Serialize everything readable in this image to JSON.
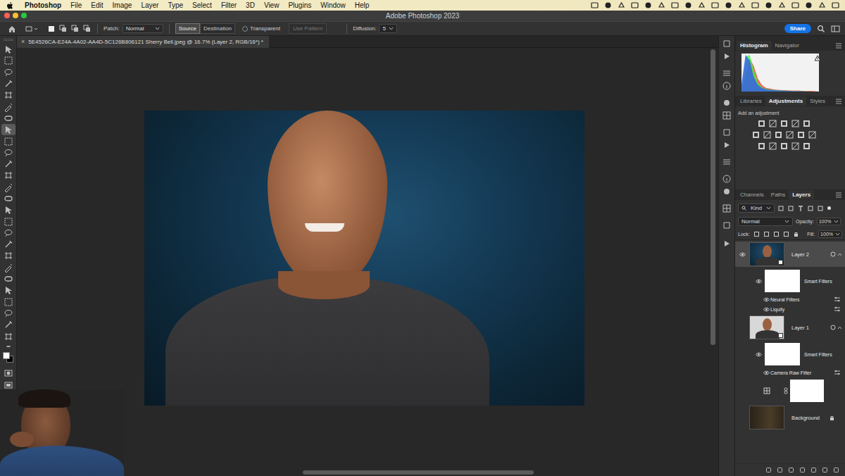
{
  "menubar": {
    "app": "Photoshop",
    "items": [
      "File",
      "Edit",
      "Image",
      "Layer",
      "Type",
      "Select",
      "Filter",
      "3D",
      "View",
      "Plugins",
      "Window",
      "Help"
    ]
  },
  "window": {
    "title": "Adobe Photoshop 2023"
  },
  "toolbar": {
    "tools": [
      {
        "selected": false
      },
      {
        "selected": false
      },
      {
        "selected": false
      },
      {
        "selected": false
      },
      {
        "selected": false
      },
      {
        "selected": false
      },
      {
        "selected": false
      },
      {
        "selected": true
      },
      {
        "selected": false
      },
      {
        "selected": false
      },
      {
        "selected": false
      },
      {
        "selected": false
      },
      {
        "selected": false
      },
      {
        "selected": false
      },
      {
        "selected": false
      },
      {
        "selected": false
      },
      {
        "selected": false
      },
      {
        "selected": false
      },
      {
        "selected": false
      },
      {
        "selected": false
      },
      {
        "selected": false
      },
      {
        "selected": false
      },
      {
        "selected": false
      },
      {
        "selected": false
      },
      {
        "selected": false
      },
      {
        "selected": false
      }
    ],
    "more": "•••"
  },
  "options": {
    "patch_label": "Patch:",
    "patch_mode": "Normal",
    "source": {
      "label": "Source",
      "selected": true
    },
    "destination": {
      "label": "Destination",
      "selected": false
    },
    "transparent": {
      "label": "Transparent",
      "checked": false
    },
    "use_pattern": {
      "label": "Use Pattern",
      "disabled": true
    },
    "diffusion_label": "Diffusion:",
    "diffusion_value": "5",
    "share": "Share"
  },
  "document": {
    "close": "×",
    "tab": "5E4526CA-E24A-4A02-AA4D-5C126B806121 Sherry Bell.jpeg @ 16.7% (Layer 2, RGB/16*) *"
  },
  "panels": {
    "top_tabs": [
      {
        "label": "Histogram",
        "selected": true
      },
      {
        "label": "Navigator",
        "selected": false
      }
    ],
    "histogram": {
      "series": [
        {
          "color": "#ff3030",
          "values": [
            5,
            40,
            90,
            70,
            35,
            18,
            10,
            8,
            6,
            5,
            4,
            4,
            3,
            3,
            3,
            2,
            2,
            2,
            1,
            0
          ]
        },
        {
          "color": "#30ff30",
          "values": [
            10,
            95,
            100,
            60,
            25,
            12,
            8,
            6,
            5,
            4,
            3,
            3,
            2,
            2,
            1,
            1,
            1,
            0,
            0,
            0
          ]
        },
        {
          "color": "#3050ff",
          "values": [
            20,
            100,
            85,
            40,
            18,
            10,
            7,
            5,
            4,
            3,
            3,
            2,
            2,
            1,
            1,
            1,
            0,
            0,
            0,
            0
          ]
        }
      ]
    },
    "mid_tabs": [
      {
        "label": "Libraries",
        "selected": false
      },
      {
        "label": "Adjustments",
        "selected": true
      },
      {
        "label": "Styles",
        "selected": false
      }
    ],
    "adjust_hint": "Add an adjustment",
    "bottom_tabs": [
      {
        "label": "Channels",
        "selected": false
      },
      {
        "label": "Paths",
        "selected": false
      },
      {
        "label": "Layers",
        "selected": true
      }
    ]
  },
  "layers_panel": {
    "filter": "Kind",
    "blend": "Normal",
    "opacity_label": "Opacity:",
    "opacity": "100%",
    "lock_label": "Lock:",
    "fill_label": "Fill:",
    "fill": "100%",
    "layers": [
      {
        "kind": "layer",
        "name": "Layer 2",
        "visible": true,
        "selected": true
      },
      {
        "kind": "smart-filters",
        "name": "Smart Filters",
        "visible": true
      },
      {
        "kind": "filter",
        "name": "Neural Filters",
        "visible": true
      },
      {
        "kind": "filter",
        "name": "Liquify",
        "visible": true
      },
      {
        "kind": "layer",
        "name": "Layer 1",
        "visible": false,
        "selected": false
      },
      {
        "kind": "smart-filters",
        "name": "Smart Filters",
        "visible": true
      },
      {
        "kind": "filter",
        "name": "Camera Raw Filter",
        "visible": true
      },
      {
        "kind": "adjustment",
        "visible": false
      },
      {
        "kind": "background",
        "name": "Background",
        "visible": false,
        "selected": false
      }
    ]
  }
}
